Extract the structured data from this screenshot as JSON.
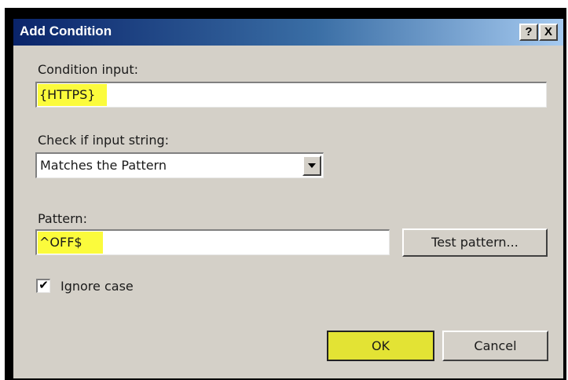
{
  "dialog": {
    "title": "Add Condition",
    "help_label": "?",
    "close_label": "X"
  },
  "condition_input": {
    "label": "Condition input:",
    "value": "{HTTPS}"
  },
  "check_input": {
    "label": "Check if input string:",
    "selected": "Matches the Pattern"
  },
  "pattern": {
    "label": "Pattern:",
    "value": "^OFF$",
    "test_button": "Test pattern..."
  },
  "ignore_case": {
    "label": "Ignore case",
    "checked_mark": "✔"
  },
  "buttons": {
    "ok": "OK",
    "cancel": "Cancel"
  },
  "colors": {
    "highlight": "#fbfb3c",
    "dialog_bg": "#d4d0c8",
    "titlebar": "#0a246a"
  }
}
